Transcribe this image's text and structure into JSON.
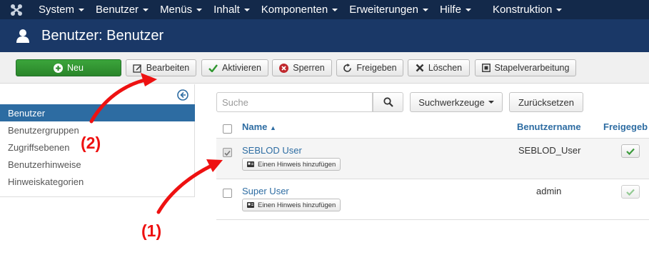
{
  "topbar": {
    "menu": [
      {
        "label": "System"
      },
      {
        "label": "Benutzer"
      },
      {
        "label": "Menüs"
      },
      {
        "label": "Inhalt"
      },
      {
        "label": "Komponenten"
      },
      {
        "label": "Erweiterungen"
      },
      {
        "label": "Hilfe"
      },
      {
        "label": "Konstruktion"
      }
    ]
  },
  "page": {
    "title": "Benutzer: Benutzer"
  },
  "toolbar": {
    "new": "Neu",
    "edit": "Bearbeiten",
    "activate": "Aktivieren",
    "block": "Sperren",
    "unblock": "Freigeben",
    "delete": "Löschen",
    "batch": "Stapelverarbeitung"
  },
  "sidebar": {
    "items": [
      {
        "label": "Benutzer",
        "active": true
      },
      {
        "label": "Benutzergruppen"
      },
      {
        "label": "Zugriffsebenen"
      },
      {
        "label": "Benutzerhinweise"
      },
      {
        "label": "Hinweiskategorien"
      }
    ]
  },
  "filter": {
    "search_placeholder": "Suche",
    "tools": "Suchwerkzeuge",
    "reset": "Zurücksetzen"
  },
  "table": {
    "columns": {
      "name": "Name",
      "username": "Benutzername",
      "status": "Freigegeb"
    },
    "rows": [
      {
        "name": "SEBLOD User",
        "note": "Einen Hinweis hinzufügen",
        "username": "SEBLOD_User",
        "checked": true
      },
      {
        "name": "Super User",
        "note": "Einen Hinweis hinzufügen",
        "username": "admin",
        "checked": false
      }
    ]
  },
  "annotations": {
    "one": "(1)",
    "two": "(2)"
  },
  "colors": {
    "topbar": "#13294a",
    "header": "#1a3867",
    "active": "#2d6ca2",
    "new_button": "#2f962f",
    "annotation": "#ee1111"
  }
}
